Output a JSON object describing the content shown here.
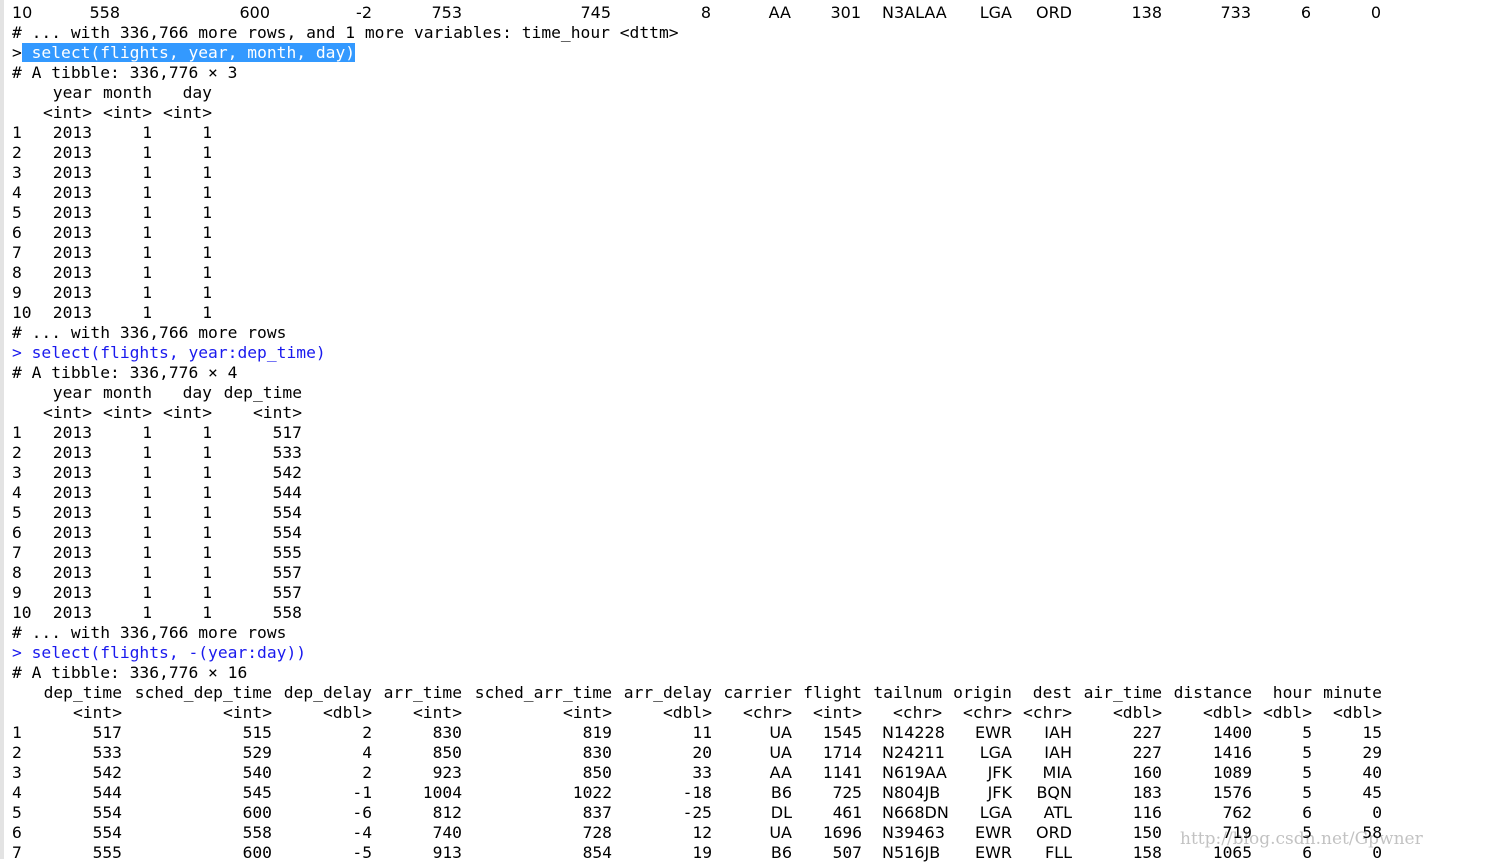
{
  "console": {
    "top_row": [
      "10",
      "558",
      "600",
      "-2",
      "753",
      "745",
      "8",
      "AA",
      "301",
      "N3ALAA",
      "LGA",
      "ORD",
      "138",
      "733",
      "6",
      "0"
    ],
    "more1": "# ... with 336,766 more rows, and 1 more variables: time_hour <dttm>",
    "cmd1_prompt": ">",
    "cmd1_text": " select(flights, year, month, day)",
    "tibble1": "# A tibble: 336,776 × 3",
    "t1_header": [
      "year",
      "month",
      "day"
    ],
    "t1_types": [
      "<int>",
      "<int>",
      "<int>"
    ],
    "t1_rows": [
      [
        "1",
        "2013",
        "1",
        "1"
      ],
      [
        "2",
        "2013",
        "1",
        "1"
      ],
      [
        "3",
        "2013",
        "1",
        "1"
      ],
      [
        "4",
        "2013",
        "1",
        "1"
      ],
      [
        "5",
        "2013",
        "1",
        "1"
      ],
      [
        "6",
        "2013",
        "1",
        "1"
      ],
      [
        "7",
        "2013",
        "1",
        "1"
      ],
      [
        "8",
        "2013",
        "1",
        "1"
      ],
      [
        "9",
        "2013",
        "1",
        "1"
      ],
      [
        "10",
        "2013",
        "1",
        "1"
      ]
    ],
    "more2": "# ... with 336,766 more rows",
    "cmd2": "> select(flights, year:dep_time)",
    "tibble2": "# A tibble: 336,776 × 4",
    "t2_header": [
      "year",
      "month",
      "day",
      "dep_time"
    ],
    "t2_types": [
      "<int>",
      "<int>",
      "<int>",
      "<int>"
    ],
    "t2_rows": [
      [
        "1",
        "2013",
        "1",
        "1",
        "517"
      ],
      [
        "2",
        "2013",
        "1",
        "1",
        "533"
      ],
      [
        "3",
        "2013",
        "1",
        "1",
        "542"
      ],
      [
        "4",
        "2013",
        "1",
        "1",
        "544"
      ],
      [
        "5",
        "2013",
        "1",
        "1",
        "554"
      ],
      [
        "6",
        "2013",
        "1",
        "1",
        "554"
      ],
      [
        "7",
        "2013",
        "1",
        "1",
        "555"
      ],
      [
        "8",
        "2013",
        "1",
        "1",
        "557"
      ],
      [
        "9",
        "2013",
        "1",
        "1",
        "557"
      ],
      [
        "10",
        "2013",
        "1",
        "1",
        "558"
      ]
    ],
    "more3": "# ... with 336,766 more rows",
    "cmd3": "> select(flights, -(year:day))",
    "tibble3": "# A tibble: 336,776 × 16",
    "t3_header": [
      "dep_time",
      "sched_dep_time",
      "dep_delay",
      "arr_time",
      "sched_arr_time",
      "arr_delay",
      "carrier",
      "flight",
      "tailnum",
      "origin",
      "dest",
      "air_time",
      "distance",
      "hour",
      "minute"
    ],
    "t3_types": [
      "<int>",
      "<int>",
      "<dbl>",
      "<int>",
      "<int>",
      "<dbl>",
      "<chr>",
      "<int>",
      "<chr>",
      "<chr>",
      "<chr>",
      "<dbl>",
      "<dbl>",
      "<dbl>",
      "<dbl>"
    ],
    "t3_rows": [
      [
        "1",
        "517",
        "515",
        "2",
        "830",
        "819",
        "11",
        "UA",
        "1545",
        "N14228",
        "EWR",
        "IAH",
        "227",
        "1400",
        "5",
        "15"
      ],
      [
        "2",
        "533",
        "529",
        "4",
        "850",
        "830",
        "20",
        "UA",
        "1714",
        "N24211",
        "LGA",
        "IAH",
        "227",
        "1416",
        "5",
        "29"
      ],
      [
        "3",
        "542",
        "540",
        "2",
        "923",
        "850",
        "33",
        "AA",
        "1141",
        "N619AA",
        "JFK",
        "MIA",
        "160",
        "1089",
        "5",
        "40"
      ],
      [
        "4",
        "544",
        "545",
        "-1",
        "1004",
        "1022",
        "-18",
        "B6",
        "725",
        "N804JB",
        "JFK",
        "BQN",
        "183",
        "1576",
        "5",
        "45"
      ],
      [
        "5",
        "554",
        "600",
        "-6",
        "812",
        "837",
        "-25",
        "DL",
        "461",
        "N668DN",
        "LGA",
        "ATL",
        "116",
        "762",
        "6",
        "0"
      ],
      [
        "6",
        "554",
        "558",
        "-4",
        "740",
        "728",
        "12",
        "UA",
        "1696",
        "N39463",
        "EWR",
        "ORD",
        "150",
        "719",
        "5",
        "58"
      ],
      [
        "7",
        "555",
        "600",
        "-5",
        "913",
        "854",
        "19",
        "B6",
        "507",
        "N516JB",
        "EWR",
        "FLL",
        "158",
        "1065",
        "6",
        "0"
      ]
    ],
    "watermark": "http://blog.csdn.net/Gpwner"
  }
}
